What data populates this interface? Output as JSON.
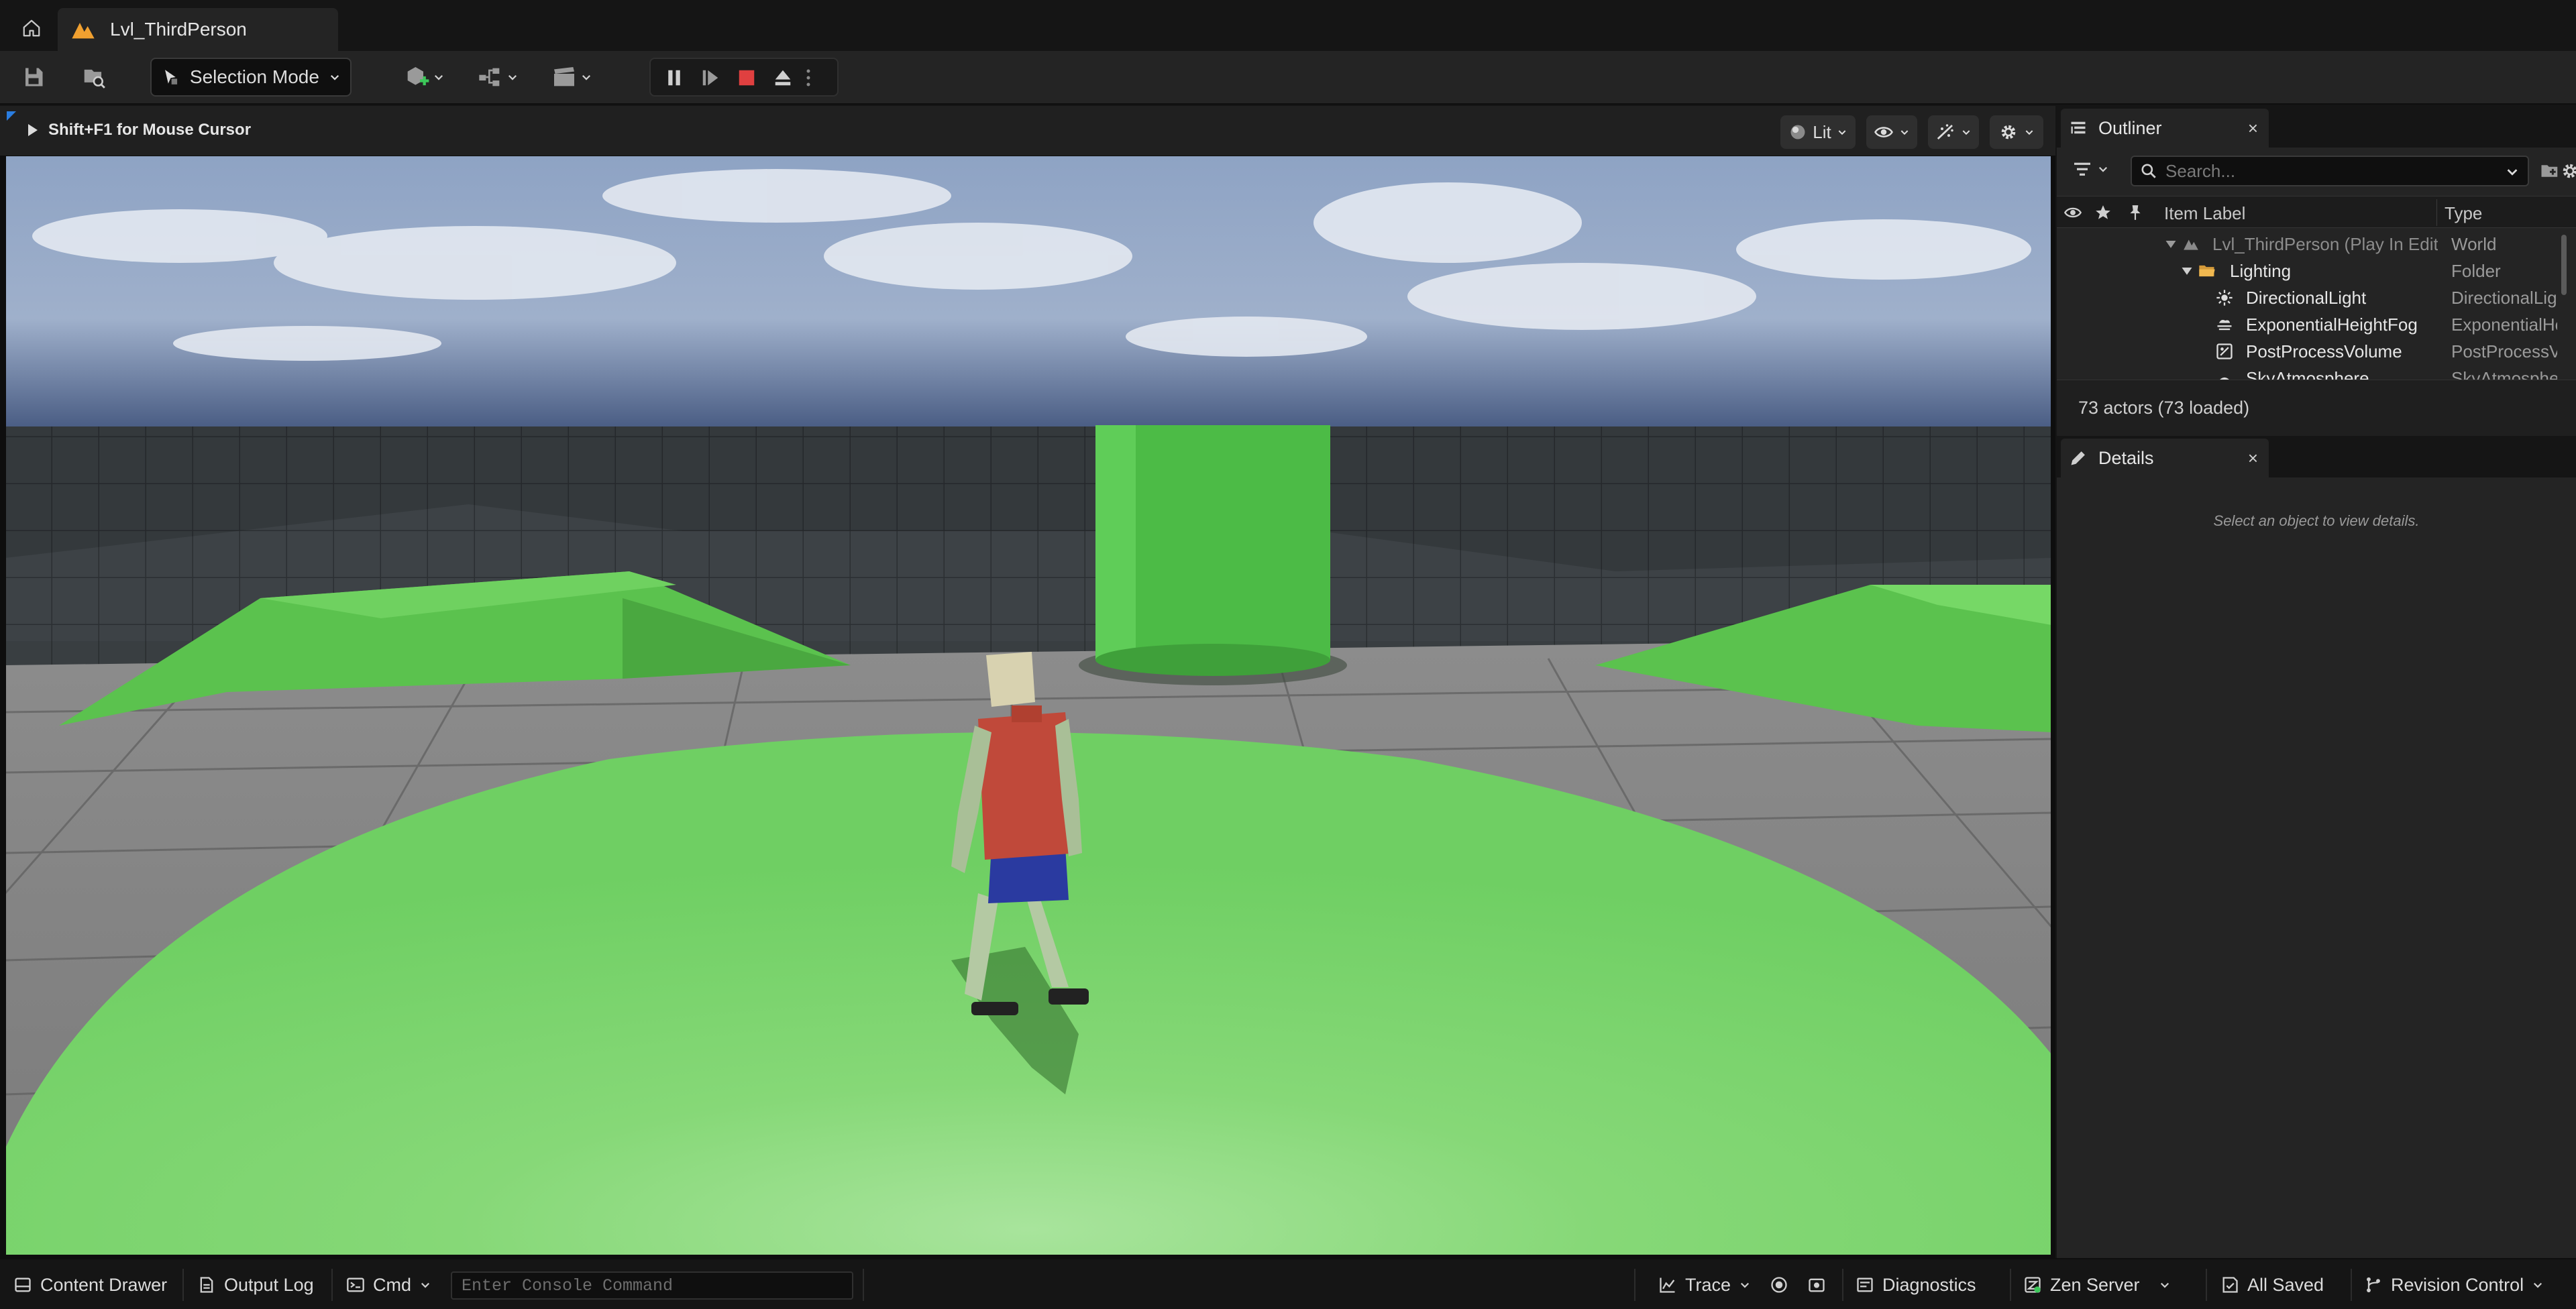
{
  "window": {
    "tab_title": "Lvl_ThirdPerson"
  },
  "toolbar": {
    "mode_label": "Selection Mode"
  },
  "viewport": {
    "hint": "Shift+F1 for Mouse Cursor",
    "view_mode_label": "Lit"
  },
  "outliner": {
    "tab_label": "Outliner",
    "close_glyph": "×",
    "search_placeholder": "Search...",
    "columns": {
      "item_label": "Item Label",
      "type": "Type"
    },
    "rows": [
      {
        "label": "Lvl_ThirdPerson (Play In Editor)",
        "type": "World",
        "icon": "world-icon"
      },
      {
        "label": "Lighting",
        "type": "Folder",
        "icon": "folder-icon"
      },
      {
        "label": "DirectionalLight",
        "type": "DirectionalLight",
        "icon": "directional-light-icon"
      },
      {
        "label": "ExponentialHeightFog",
        "type": "ExponentialHeightFog",
        "icon": "fog-icon"
      },
      {
        "label": "PostProcessVolume",
        "type": "PostProcessVolume",
        "icon": "post-process-icon"
      },
      {
        "label": "SkyAtmosphere",
        "type": "SkyAtmosphere",
        "icon": "sky-atmosphere-icon"
      }
    ],
    "actor_count": "73 actors (73 loaded)"
  },
  "details": {
    "tab_label": "Details",
    "close_glyph": "×",
    "empty_message": "Select an object to view details."
  },
  "statusbar": {
    "content_drawer": "Content Drawer",
    "output_log": "Output Log",
    "cmd": "Cmd",
    "console_placeholder": "Enter Console Command",
    "trace": "Trace",
    "diagnostics": "Diagnostics",
    "zen_server": "Zen Server",
    "all_saved": "All Saved",
    "revision_control": "Revision Control"
  },
  "colors": {
    "accent_orange": "#f0a030",
    "stop_red": "#e04040",
    "ground_green": "#7ad66c",
    "floor_grey": "#8a8a8a"
  }
}
